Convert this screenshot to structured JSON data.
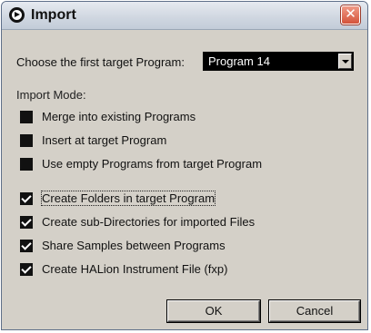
{
  "window": {
    "title": "Import",
    "close_symbol": "✕",
    "icons": {
      "app": "record-circle-icon",
      "close": "close-icon"
    }
  },
  "target": {
    "label": "Choose the first target Program:",
    "selected": "Program 14"
  },
  "import_mode": {
    "label": "Import Mode:",
    "options": [
      {
        "label": "Merge into existing Programs",
        "checked": false
      },
      {
        "label": "Insert at target Program",
        "checked": false
      },
      {
        "label": "Use empty Programs from target Program",
        "checked": false
      }
    ]
  },
  "options": [
    {
      "label": "Create Folders in target Program",
      "checked": true,
      "focused": true
    },
    {
      "label": "Create sub-Directories for imported Files",
      "checked": true
    },
    {
      "label": "Share Samples between Programs",
      "checked": true
    },
    {
      "label": "Create HALion Instrument File (fxp)",
      "checked": true
    }
  ],
  "buttons": {
    "ok": "OK",
    "cancel": "Cancel"
  },
  "colors": {
    "dialog_bg": "#d4d0c8",
    "checkbox": "#111111",
    "close": "#d4533a"
  }
}
